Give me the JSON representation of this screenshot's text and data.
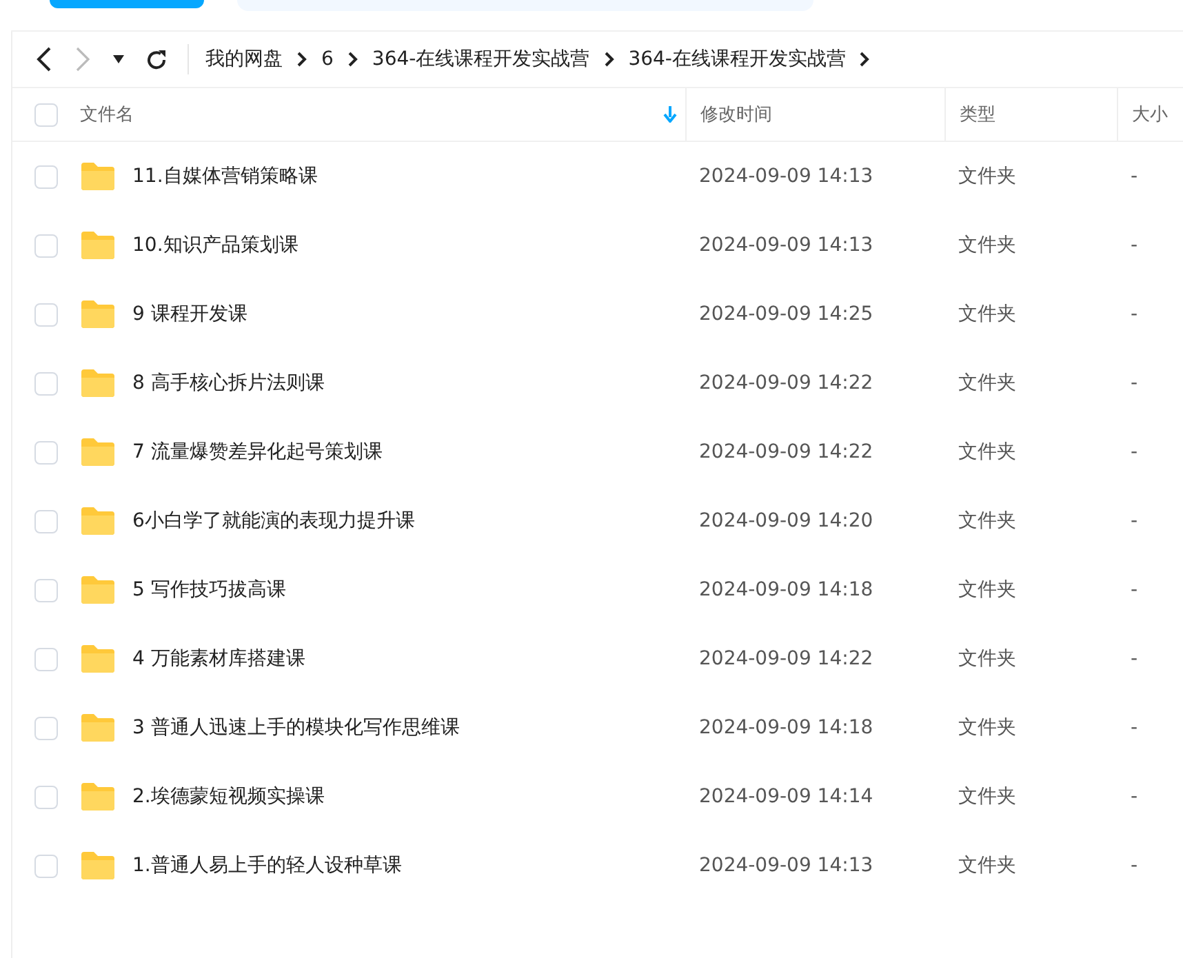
{
  "breadcrumb": [
    "我的网盘",
    "6",
    "364-在线课程开发实战营",
    "364-在线课程开发实战营"
  ],
  "header": {
    "checked": false,
    "columns": [
      "文件名",
      "修改时间",
      "类型",
      "大小"
    ]
  },
  "rows": [
    {
      "name": "11.自媒体营销策略课",
      "modified": "2024-09-09 14:13",
      "type": "文件夹",
      "size": "-",
      "checked": false
    },
    {
      "name": "10.知识产品策划课",
      "modified": "2024-09-09 14:13",
      "type": "文件夹",
      "size": "-",
      "checked": false
    },
    {
      "name": "9 课程开发课",
      "modified": "2024-09-09 14:25",
      "type": "文件夹",
      "size": "-",
      "checked": false
    },
    {
      "name": "8 高手核心拆片法则课",
      "modified": "2024-09-09 14:22",
      "type": "文件夹",
      "size": "-",
      "checked": false
    },
    {
      "name": "7 流量爆赞差异化起号策划课",
      "modified": "2024-09-09 14:22",
      "type": "文件夹",
      "size": "-",
      "checked": false
    },
    {
      "name": "6小白学了就能演的表现力提升课",
      "modified": "2024-09-09 14:20",
      "type": "文件夹",
      "size": "-",
      "checked": false
    },
    {
      "name": "5 写作技巧拔高课",
      "modified": "2024-09-09 14:18",
      "type": "文件夹",
      "size": "-",
      "checked": false
    },
    {
      "name": "4 万能素材库搭建课",
      "modified": "2024-09-09 14:22",
      "type": "文件夹",
      "size": "-",
      "checked": false
    },
    {
      "name": "3 普通人迅速上手的模块化写作思维课",
      "modified": "2024-09-09 14:18",
      "type": "文件夹",
      "size": "-",
      "checked": false
    },
    {
      "name": "2.埃德蒙短视频实操课",
      "modified": "2024-09-09 14:14",
      "type": "文件夹",
      "size": "-",
      "checked": false
    },
    {
      "name": "1.普通人易上手的轻人设种草课",
      "modified": "2024-09-09 14:13",
      "type": "文件夹",
      "size": "-",
      "checked": false
    }
  ]
}
